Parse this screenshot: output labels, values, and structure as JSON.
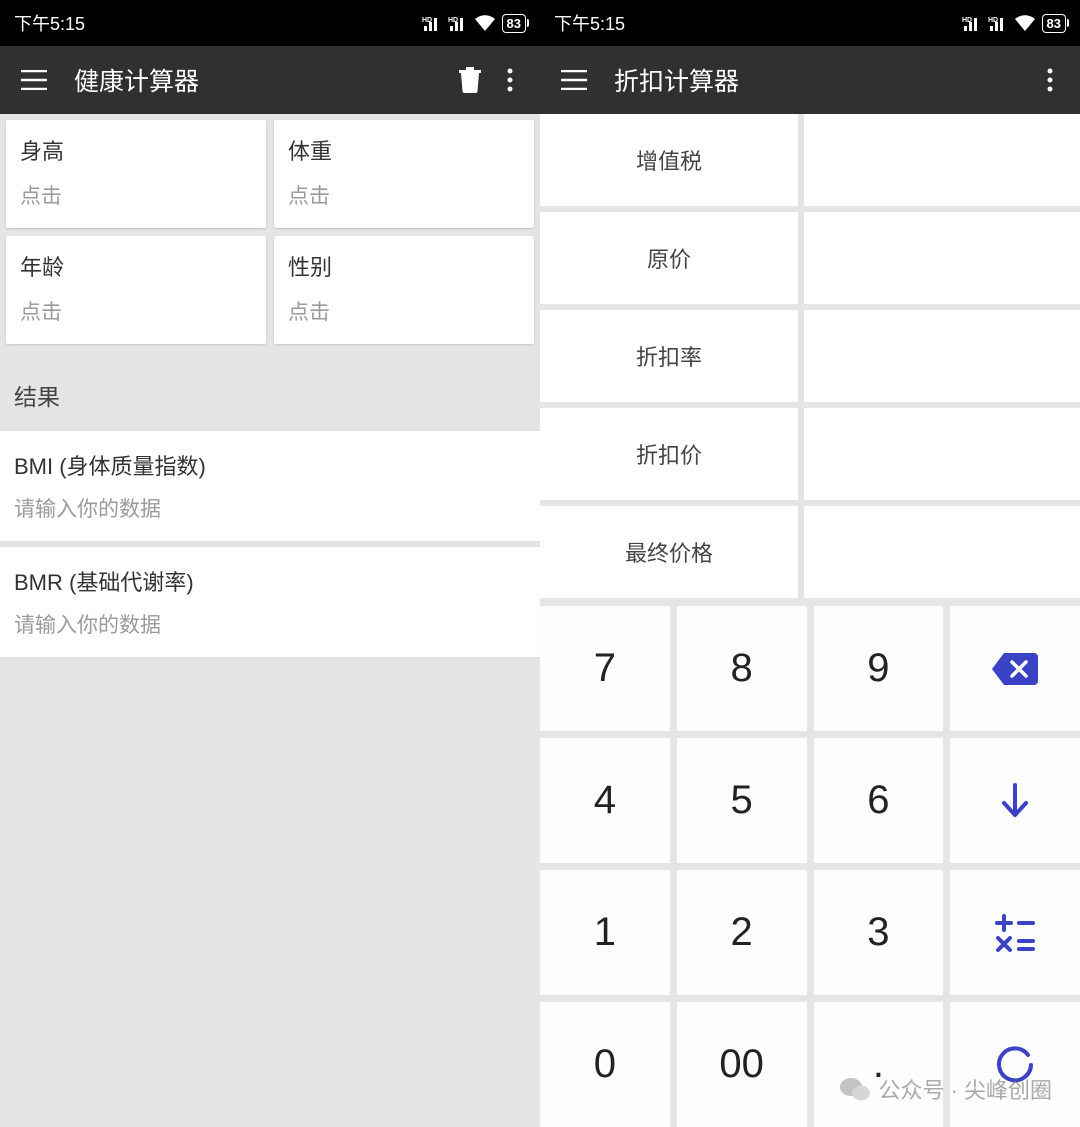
{
  "statusbar": {
    "time": "下午5:15",
    "battery": "83"
  },
  "left": {
    "title": "健康计算器",
    "inputs": [
      {
        "label": "身高",
        "hint": "点击"
      },
      {
        "label": "体重",
        "hint": "点击"
      },
      {
        "label": "年龄",
        "hint": "点击"
      },
      {
        "label": "性别",
        "hint": "点击"
      }
    ],
    "results_header": "结果",
    "results": [
      {
        "title": "BMI (身体质量指数)",
        "sub": "请输入你的数据"
      },
      {
        "title": "BMR (基础代谢率)",
        "sub": "请输入你的数据"
      }
    ]
  },
  "right": {
    "title": "折扣计算器",
    "fields": [
      {
        "label": "增值税"
      },
      {
        "label": "原价"
      },
      {
        "label": "折扣率"
      },
      {
        "label": "折扣价"
      },
      {
        "label": "最终价格"
      }
    ],
    "keypad": [
      [
        {
          "text": "7"
        },
        {
          "text": "8"
        },
        {
          "text": "9"
        },
        {
          "icon": "backspace"
        }
      ],
      [
        {
          "text": "4"
        },
        {
          "text": "5"
        },
        {
          "text": "6"
        },
        {
          "icon": "arrow-down"
        }
      ],
      [
        {
          "text": "1"
        },
        {
          "text": "2"
        },
        {
          "text": "3"
        },
        {
          "icon": "operators"
        }
      ],
      [
        {
          "text": "0"
        },
        {
          "text": "00"
        },
        {
          "text": "."
        },
        {
          "icon": "reset"
        }
      ]
    ]
  },
  "watermark": {
    "text": "公众号 · 尖峰创圈"
  }
}
